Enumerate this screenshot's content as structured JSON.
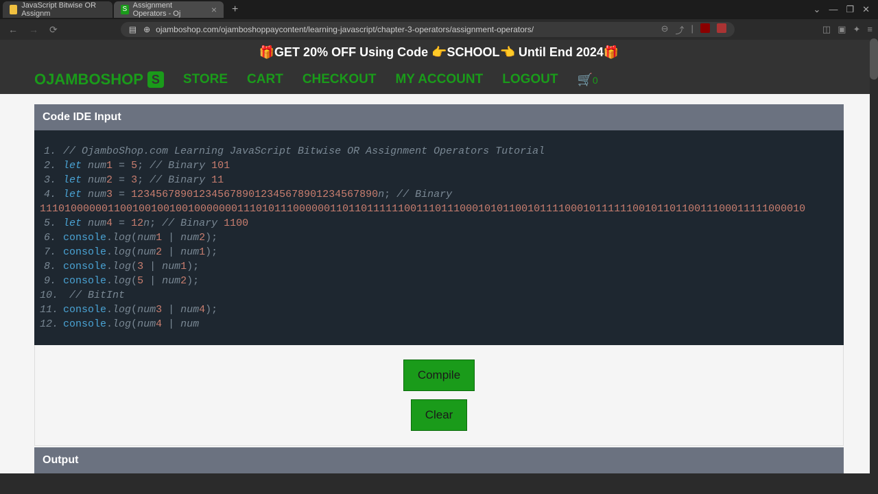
{
  "browser": {
    "tabs": [
      {
        "title": "JavaScript Bitwise OR Assignm"
      },
      {
        "title": "Assignment Operators - Oj"
      }
    ],
    "url": "ojamboshop.com/ojamboshoppaycontent/learning-javascript/chapter-3-operators/assignment-operators/",
    "window_controls": {
      "min": "—",
      "max": "❐",
      "close": "✕"
    }
  },
  "promo": {
    "text": "🎁GET 20% OFF Using Code 👉SCHOOL👈 Until End 2024🎁"
  },
  "nav": {
    "brand": "OJAMBOSHOP",
    "links": [
      "STORE",
      "CART",
      "CHECKOUT",
      "MY ACCOUNT",
      "LOGOUT"
    ],
    "cart_count": "0"
  },
  "ide": {
    "input_header": "Code IDE Input",
    "output_header": "Output",
    "compile_label": "Compile",
    "clear_label": "Clear",
    "code_lines": [
      {
        "n": "1.",
        "tokens": [
          {
            "t": "cm",
            "v": "// OjamboShop.com Learning JavaScript Bitwise OR Assignment Operators Tutorial"
          }
        ]
      },
      {
        "n": "2.",
        "tokens": [
          {
            "t": "kw",
            "v": "let "
          },
          {
            "t": "va",
            "v": "num"
          },
          {
            "t": "nm",
            "v": "1"
          },
          {
            "t": "op",
            "v": " = "
          },
          {
            "t": "nm",
            "v": "5"
          },
          {
            "t": "pn",
            "v": ";"
          },
          {
            "t": "cm",
            "v": " // Binary "
          },
          {
            "t": "nm",
            "v": "101"
          }
        ]
      },
      {
        "n": "3.",
        "tokens": [
          {
            "t": "kw",
            "v": "let "
          },
          {
            "t": "va",
            "v": "num"
          },
          {
            "t": "nm",
            "v": "2"
          },
          {
            "t": "op",
            "v": " = "
          },
          {
            "t": "nm",
            "v": "3"
          },
          {
            "t": "pn",
            "v": ";"
          },
          {
            "t": "cm",
            "v": " // Binary "
          },
          {
            "t": "nm",
            "v": "11"
          }
        ]
      },
      {
        "n": "4.",
        "tokens": [
          {
            "t": "kw",
            "v": "let "
          },
          {
            "t": "va",
            "v": "num"
          },
          {
            "t": "nm",
            "v": "3"
          },
          {
            "t": "op",
            "v": " = "
          },
          {
            "t": "nm",
            "v": "1234567890123456789012345678901234567890"
          },
          {
            "t": "va",
            "v": "n"
          },
          {
            "t": "pn",
            "v": ";"
          },
          {
            "t": "cm",
            "v": "  // Binary"
          }
        ]
      },
      {
        "n": "",
        "wrap": true,
        "tokens": [
          {
            "t": "nm",
            "v": "1110100000011001001001001000000011101011100000011011011111100111011100010101100101111000101111110010110110011100011111000010"
          }
        ]
      },
      {
        "n": "5.",
        "tokens": [
          {
            "t": "kw",
            "v": "let "
          },
          {
            "t": "va",
            "v": "num"
          },
          {
            "t": "nm",
            "v": "4"
          },
          {
            "t": "op",
            "v": " = "
          },
          {
            "t": "nm",
            "v": "12"
          },
          {
            "t": "va",
            "v": "n"
          },
          {
            "t": "pn",
            "v": ";"
          },
          {
            "t": "cm",
            "v": " // Binary "
          },
          {
            "t": "nm",
            "v": "1100"
          }
        ]
      },
      {
        "n": "6.",
        "tokens": [
          {
            "t": "fn",
            "v": "console"
          },
          {
            "t": "pn",
            "v": "."
          },
          {
            "t": "mt",
            "v": "log"
          },
          {
            "t": "pn",
            "v": "("
          },
          {
            "t": "va",
            "v": "num"
          },
          {
            "t": "nm",
            "v": "1"
          },
          {
            "t": "op",
            "v": " | "
          },
          {
            "t": "va",
            "v": "num"
          },
          {
            "t": "nm",
            "v": "2"
          },
          {
            "t": "pn",
            "v": ");"
          }
        ]
      },
      {
        "n": "7.",
        "tokens": [
          {
            "t": "fn",
            "v": "console"
          },
          {
            "t": "pn",
            "v": "."
          },
          {
            "t": "mt",
            "v": "log"
          },
          {
            "t": "pn",
            "v": "("
          },
          {
            "t": "va",
            "v": "num"
          },
          {
            "t": "nm",
            "v": "2"
          },
          {
            "t": "op",
            "v": " | "
          },
          {
            "t": "va",
            "v": "num"
          },
          {
            "t": "nm",
            "v": "1"
          },
          {
            "t": "pn",
            "v": ");"
          }
        ]
      },
      {
        "n": "8.",
        "tokens": [
          {
            "t": "fn",
            "v": "console"
          },
          {
            "t": "pn",
            "v": "."
          },
          {
            "t": "mt",
            "v": "log"
          },
          {
            "t": "pn",
            "v": "("
          },
          {
            "t": "nm",
            "v": "3"
          },
          {
            "t": "op",
            "v": " | "
          },
          {
            "t": "va",
            "v": "num"
          },
          {
            "t": "nm",
            "v": "1"
          },
          {
            "t": "pn",
            "v": ");"
          }
        ]
      },
      {
        "n": "9.",
        "tokens": [
          {
            "t": "fn",
            "v": "console"
          },
          {
            "t": "pn",
            "v": "."
          },
          {
            "t": "mt",
            "v": "log"
          },
          {
            "t": "pn",
            "v": "("
          },
          {
            "t": "nm",
            "v": "5"
          },
          {
            "t": "op",
            "v": " | "
          },
          {
            "t": "va",
            "v": "num"
          },
          {
            "t": "nm",
            "v": "2"
          },
          {
            "t": "pn",
            "v": ");"
          }
        ]
      },
      {
        "n": "10.",
        "tokens": [
          {
            "t": "cm",
            "v": " // BitInt"
          }
        ]
      },
      {
        "n": "11.",
        "tokens": [
          {
            "t": "fn",
            "v": "console"
          },
          {
            "t": "pn",
            "v": "."
          },
          {
            "t": "mt",
            "v": "log"
          },
          {
            "t": "pn",
            "v": "("
          },
          {
            "t": "va",
            "v": "num"
          },
          {
            "t": "nm",
            "v": "3"
          },
          {
            "t": "op",
            "v": "  | "
          },
          {
            "t": "va",
            "v": "num"
          },
          {
            "t": "nm",
            "v": "4"
          },
          {
            "t": "pn",
            "v": ");"
          }
        ]
      },
      {
        "n": "12.",
        "tokens": [
          {
            "t": "fn",
            "v": "console"
          },
          {
            "t": "pn",
            "v": "."
          },
          {
            "t": "mt",
            "v": "log"
          },
          {
            "t": "pn",
            "v": "("
          },
          {
            "t": "va",
            "v": "num"
          },
          {
            "t": "nm",
            "v": "4"
          },
          {
            "t": "op",
            "v": "  | "
          },
          {
            "t": "va",
            "v": "num"
          }
        ]
      }
    ]
  }
}
